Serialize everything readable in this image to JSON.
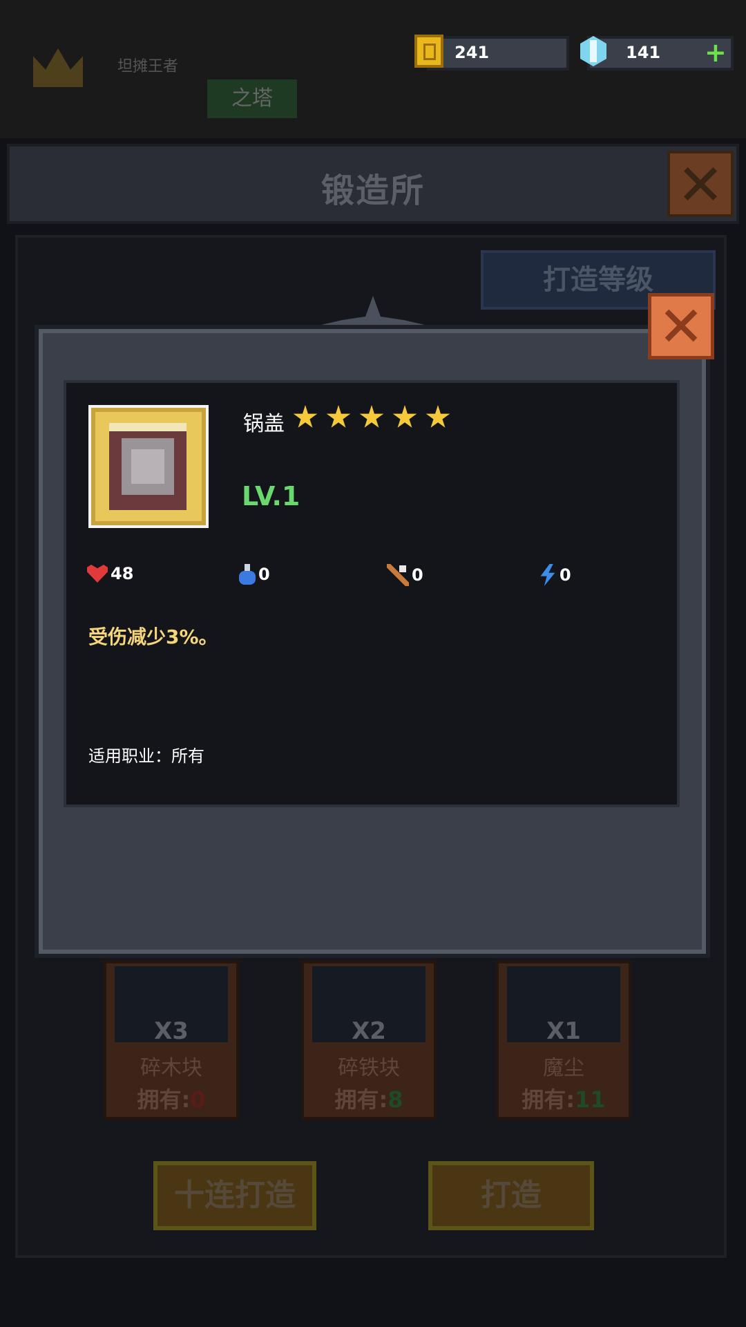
{
  "top_bar": {
    "player_name": "坦摊王者",
    "tag_text": "之塔",
    "coins": "241",
    "gems": "141",
    "plus_label": "+"
  },
  "forge": {
    "title": "锻造所",
    "level_button": "打造等级",
    "materials": [
      {
        "qty": "X3",
        "name": "碎木块",
        "own_label": "拥有:",
        "own_value": "0"
      },
      {
        "qty": "X2",
        "name": "碎铁块",
        "own_label": "拥有:",
        "own_value": "8"
      },
      {
        "qty": "X1",
        "name": "魔尘",
        "own_label": "拥有:",
        "own_value": "11"
      }
    ],
    "ten_forge_button": "十连打造",
    "forge_button": "打造"
  },
  "popup": {
    "item_name": "锅盖",
    "stars": 5,
    "level": "LV.1",
    "stats": {
      "hp": "48",
      "mp": "0",
      "attack": "0",
      "energy": "0"
    },
    "description": "受伤减少3%。",
    "class_text": "适用职业：所有"
  },
  "colors": {
    "star": "#f6c93b",
    "level_green": "#6bd86f",
    "description_gold": "#f6d67a",
    "close_orange": "#e07a48"
  },
  "icons": [
    "crown-icon",
    "coin-icon",
    "gem-icon",
    "plus-icon",
    "close-icon",
    "heart-icon",
    "potion-icon",
    "sword-icon",
    "bolt-icon",
    "star-icon"
  ]
}
